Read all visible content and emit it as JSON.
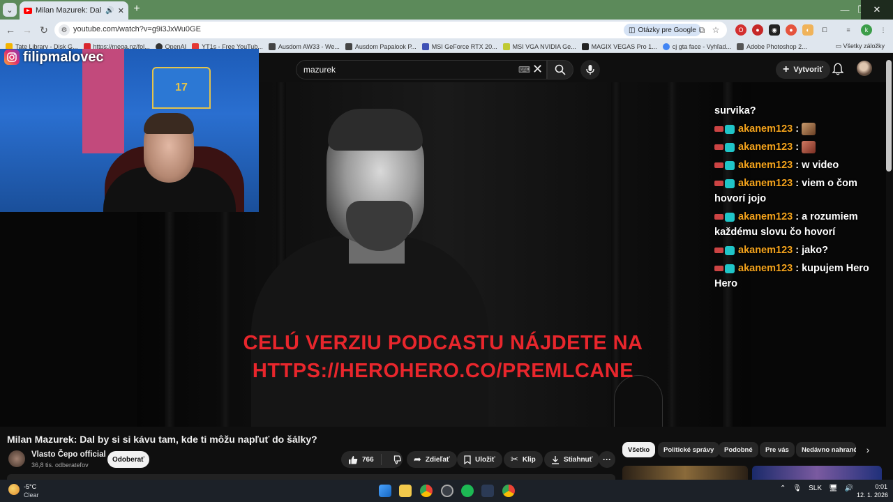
{
  "browser": {
    "tab_title": "Milan Mazurek: Dal by si s",
    "url": "youtube.com/watch?v=g9i3JxWu0GE",
    "ask_google": "Otázky pre Google",
    "bookmarks": [
      "Tate Library - Disk G...",
      "https://mega.nz/fol...",
      "OpenAI",
      "YT1s - Free YouTub...",
      "Ausdom AW33 - We...",
      "Ausdom Papalook P...",
      "MSI GeForce RTX 20...",
      "MSI VGA NVIDIA Ge...",
      "MAGIX VEGAS Pro 1...",
      "cj gta face - Vyhľad...",
      "Adobe Photoshop 2..."
    ],
    "all_bookmarks": "Všetky záložky",
    "profile_initial": "k"
  },
  "youtube": {
    "search_value": "mazurek",
    "create_label": "Vytvoriť",
    "video": {
      "promo_line1": "CELÚ VERZIU PODCASTU NÁJDETE NA",
      "promo_line2": "HTTPS://HEROHERO.CO/PREMLCANE"
    },
    "title": "Milan Mazurek: Dal by si si kávu tam, kde ti môžu napľuť do šálky?",
    "channel": {
      "name": "Vlasto Čepo official",
      "subscribers": "36,8 tis. odberateľov",
      "subscribe_label": "Odoberať"
    },
    "actions": {
      "likes": "766",
      "share": "Zdieľať",
      "save": "Uložiť",
      "clip": "Klip",
      "download": "Stiahnuť"
    },
    "chips": [
      "Všetko",
      "Politické správy",
      "Podobné",
      "Pre vás",
      "Nedávno nahrané"
    ]
  },
  "overlay": {
    "instagram_handle": "filipmalovec",
    "jersey_number": "17",
    "chat": {
      "partial": "survika?",
      "messages": [
        {
          "user": "akanem123",
          "text": "",
          "emote": true
        },
        {
          "user": "akanem123",
          "text": "",
          "emote": true
        },
        {
          "user": "akanem123",
          "text": "w video",
          "emote": false
        },
        {
          "user": "akanem123",
          "text": "viem o čom hovorí jojo",
          "emote": false
        },
        {
          "user": "akanem123",
          "text": "a rozumiem každému slovu čo hovorí",
          "emote": false
        },
        {
          "user": "akanem123",
          "text": "jako?",
          "emote": false
        },
        {
          "user": "akanem123",
          "text": "kupujem Hero Hero",
          "emote": false
        }
      ]
    }
  },
  "taskbar": {
    "temperature": "-5°C",
    "weather": "Clear",
    "language": "SLK",
    "time": "0:01",
    "date": "12. 1. 2026"
  },
  "colors": {
    "accent_red": "#e8262c",
    "chat_user": "#f4a31c",
    "youtube_bg": "#0f0f0f"
  }
}
